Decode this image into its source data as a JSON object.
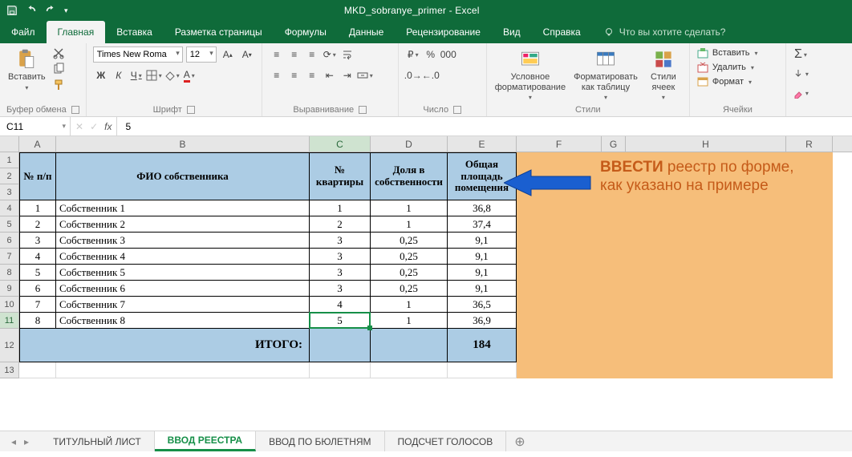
{
  "title": "MKD_sobranye_primer  -  Excel",
  "tabs": {
    "file": "Файл",
    "home": "Главная",
    "insert": "Вставка",
    "pagelayout": "Разметка страницы",
    "formulas": "Формулы",
    "data": "Данные",
    "review": "Рецензирование",
    "view": "Вид",
    "help": "Справка",
    "tellme": "Что вы хотите сделать?"
  },
  "ribbon": {
    "clipboard": {
      "paste": "Вставить",
      "label": "Буфер обмена"
    },
    "font": {
      "name": "Times New Roma",
      "size": "12",
      "label": "Шрифт"
    },
    "alignment": {
      "label": "Выравнивание"
    },
    "number": {
      "label": "Число"
    },
    "styles": {
      "cond": "Условное\nформатирование",
      "table": "Форматировать\nкак таблицу",
      "cellstyles": "Стили\nячеек",
      "label": "Стили"
    },
    "cells": {
      "insert": "Вставить",
      "delete": "Удалить",
      "format": "Формат",
      "label": "Ячейки"
    }
  },
  "namebox": "C11",
  "formula": "5",
  "columns": [
    "A",
    "B",
    "C",
    "D",
    "E",
    "F",
    "G",
    "H",
    "R"
  ],
  "rownums": [
    "1",
    "2",
    "3",
    "4",
    "5",
    "6",
    "7",
    "8",
    "9",
    "10",
    "11",
    "12",
    "13"
  ],
  "headers": {
    "A": "№ п/п",
    "B": "ФИО собственника",
    "C": "№\nквартиры",
    "D": "Доля в\nсобственности",
    "E": "Общая\nплощадь\nпомещения"
  },
  "chart_data": {
    "type": "table",
    "columns": [
      "№ п/п",
      "ФИО собственника",
      "№ квартиры",
      "Доля в собственности",
      "Общая площадь помещения"
    ],
    "rows": [
      [
        "1",
        "Собственник 1",
        "1",
        "1",
        "36,8"
      ],
      [
        "2",
        "Собственник 2",
        "2",
        "1",
        "37,4"
      ],
      [
        "3",
        "Собственник 3",
        "3",
        "0,25",
        "9,1"
      ],
      [
        "4",
        "Собственник 4",
        "3",
        "0,25",
        "9,1"
      ],
      [
        "5",
        "Собственник 5",
        "3",
        "0,25",
        "9,1"
      ],
      [
        "6",
        "Собственник 6",
        "3",
        "0,25",
        "9,1"
      ],
      [
        "7",
        "Собственник 7",
        "4",
        "1",
        "36,5"
      ],
      [
        "8",
        "Собственник 8",
        "5",
        "1",
        "36,9"
      ]
    ],
    "total_label": "ИТОГО:",
    "total_value": "184"
  },
  "annotation": {
    "bold": "ВВЕСТИ",
    "rest": " реестр по форме, как указано на примере"
  },
  "sheettabs": [
    "ТИТУЛЬНЫЙ ЛИСТ",
    "ВВОД РЕЕСТРА",
    "ВВОД ПО БЮЛЕТНЯМ",
    "ПОДСЧЕТ ГОЛОСОВ"
  ]
}
